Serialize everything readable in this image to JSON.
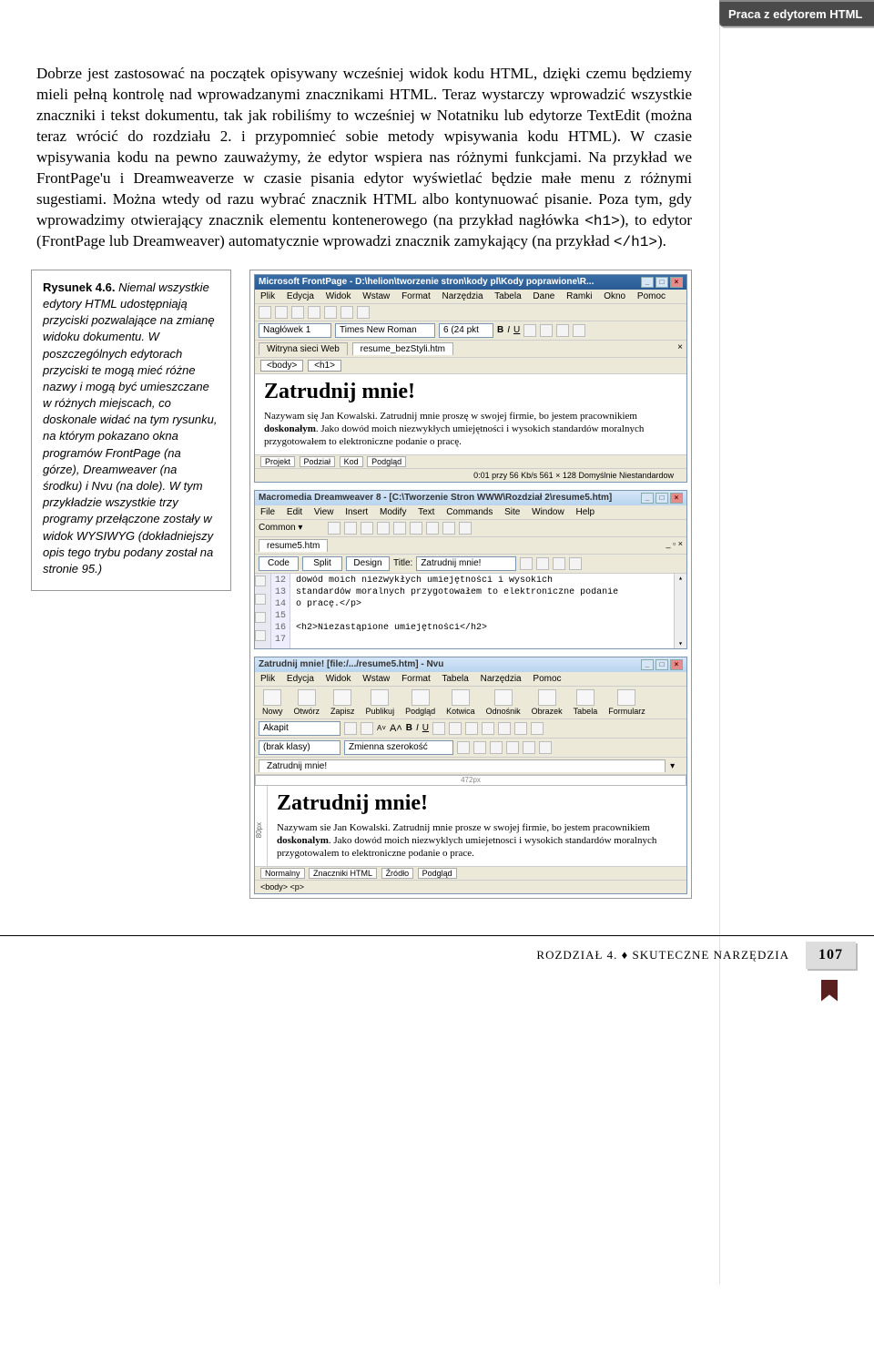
{
  "sidebar_title": "Praca z edytorem HTML",
  "body_text": "Dobrze jest zastosować na początek opisywany wcześniej widok kodu HTML, dzięki czemu będziemy mieli pełną kontrolę nad wprowadzanymi znacznikami HTML. Teraz wystarczy wprowadzić wszystkie znaczniki i tekst dokumentu, tak jak robiliśmy to wcześniej w Notatniku lub edytorze TextEdit (można teraz wrócić do rozdziału 2. i przypomnieć sobie metody wpisywania kodu HTML). W czasie wpisywania kodu na pewno zauważymy, że edytor wspiera nas różnymi funkcjami. Na przykład we FrontPage'u i Dreamweaverze w czasie pisania edytor wyświetlać będzie małe menu z różnymi sugestiami. Można wtedy od razu wybrać znacznik HTML albo kontynuować pisanie. Poza tym, gdy wprowadzimy otwierający znacznik elementu kontenerowego (na przykład nagłówka ",
  "body_code1": "<h1>",
  "body_text2": "), to edytor (FrontPage lub Dreamweaver) automatycznie wprowadzi znacznik zamykający (na przykład ",
  "body_code2": "</h1>",
  "body_text3": ").",
  "figure_label": "Rysunek 4.6.",
  "figure_caption": " Niemal wszystkie edytory HTML udostępniają przyciski pozwalające na zmianę widoku dokumentu. W poszczególnych edytorach przyciski te mogą mieć różne nazwy i mogą być umieszczane w różnych miejscach, co doskonale widać na tym rysunku, na którym pokazano okna programów FrontPage (na górze), Dreamweaver (na środku) i Nvu (na dole). W tym przykładzie wszystkie trzy programy przełączone zostały w widok WYSIWYG (dokładniejszy opis tego trybu podany został na stronie 95.)",
  "frontpage": {
    "title": "Microsoft FrontPage - D:\\helion\\tworzenie stron\\kody pl\\Kody poprawione\\R...",
    "menu": [
      "Plik",
      "Edycja",
      "Widok",
      "Wstaw",
      "Format",
      "Narzędzia",
      "Tabela",
      "Dane",
      "Ramki",
      "Okno",
      "Pomoc"
    ],
    "style_field": "Nagłówek 1",
    "font_field": "Times New Roman",
    "size_field": "6 (24 pkt",
    "tabs": [
      "Witryna sieci Web",
      "resume_bezStyli.htm"
    ],
    "breadcrumb": [
      "<body>",
      "<h1>"
    ],
    "heading": "Zatrudnij mnie!",
    "para": "Nazywam się Jan Kowalski. Zatrudnij mnie proszę w swojej firmie, bo jestem pracownikiem doskonałym. Jako dowód moich niezwykłych umiejętności i wysokich standardów moralnych przygotowałem to elektroniczne podanie o pracę.",
    "view_tabs": [
      "Projekt",
      "Podział",
      "Kod",
      "Podgląd"
    ],
    "status": "0:01 przy 56 Kb/s   561 × 128   Domyślnie   Niestandardow"
  },
  "dreamweaver": {
    "title": "Macromedia Dreamweaver 8 - [C:\\Tworzenie Stron WWW\\Rozdział 2\\resume5.htm]",
    "menu": [
      "File",
      "Edit",
      "View",
      "Insert",
      "Modify",
      "Text",
      "Commands",
      "Site",
      "Window",
      "Help"
    ],
    "common_label": "Common ▾",
    "doc_tab": "resume5.htm",
    "view_buttons": [
      "Code",
      "Split",
      "Design"
    ],
    "title_label": "Title:",
    "title_value": "Zatrudnij mnie!",
    "gutter": [
      "12",
      "13",
      "14",
      "15",
      "16",
      "17"
    ],
    "lines": [
      "dowód moich niezwykłych umiejętności i wysokich",
      "standardów moralnych przygotowałem to elektroniczne podanie",
      "o pracę.</p>",
      "",
      "<h2>Niezastąpione umiejętności</h2>",
      ""
    ]
  },
  "nvu": {
    "title": "Zatrudnij mnie! [file:/.../resume5.htm] - Nvu",
    "menu": [
      "Plik",
      "Edycja",
      "Widok",
      "Wstaw",
      "Format",
      "Tabela",
      "Narzędzia",
      "Pomoc"
    ],
    "big_buttons": [
      "Nowy",
      "Otwórz",
      "Zapisz",
      "Publikuj",
      "Podgląd",
      "Kotwica",
      "Odnośnik",
      "Obrazek",
      "Tabela",
      "Formularz"
    ],
    "style_field": "Akapit",
    "class_field": "(brak klasy)",
    "width_field": "Zmienna szerokość",
    "doc_tab": "Zatrudnij mnie!",
    "ruler": "472px",
    "side_ruler": "80px",
    "heading": "Zatrudnij mnie!",
    "para": "Nazywam sie Jan Kowalski. Zatrudnij mnie prosze w swojej firmie, bo jestem pracownikiem doskonalym. Jako dowód moich niezwyklych umiejetnosci i wysokich standardów moralnych przygotowalem to elektroniczne podanie o prace.",
    "view_tabs": [
      "Normalny",
      "Znaczniki HTML",
      "Źródło",
      "Podgląd"
    ],
    "breadcrumb": "<body>  <p>"
  },
  "footer": {
    "chapter": "ROZDZIAŁ 4. ♦ SKUTECZNE NARZĘDZIA",
    "page": "107"
  }
}
